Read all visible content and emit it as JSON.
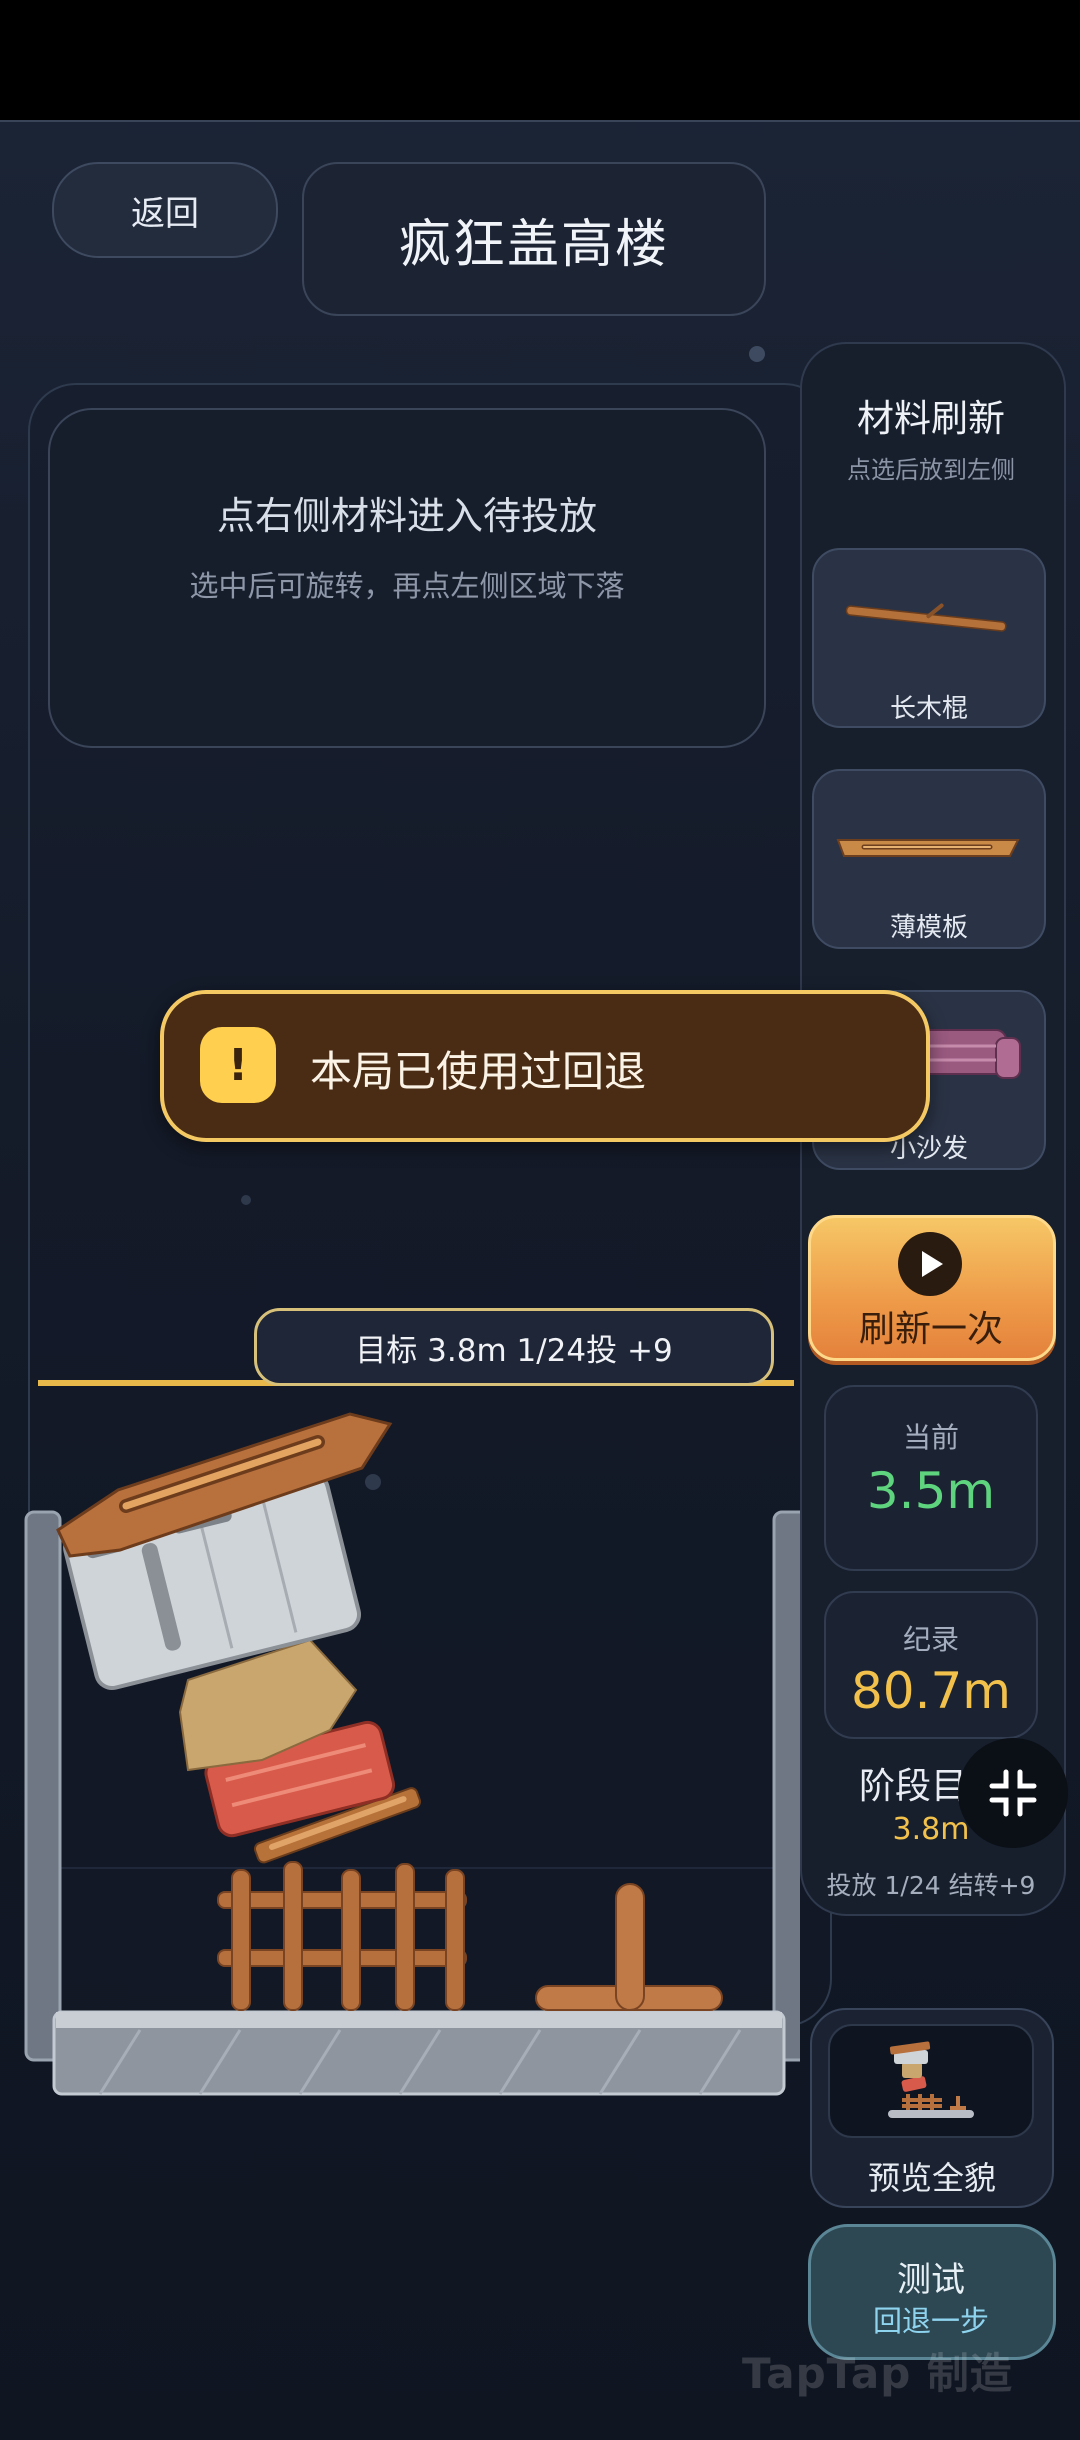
{
  "header": {
    "back_label": "返回",
    "title": "疯狂盖高楼"
  },
  "hint": {
    "title": "点右侧材料进入待投放",
    "subtitle": "选中后可旋转，再点左侧区域下落"
  },
  "panel": {
    "title": "材料刷新",
    "subtitle": "点选后放到左侧",
    "materials": [
      {
        "label": "长木棍",
        "icon": "wooden-stick-icon"
      },
      {
        "label": "薄模板",
        "icon": "thin-board-icon"
      },
      {
        "label": "小沙发",
        "icon": "small-sofa-icon"
      }
    ],
    "refresh_label": "刷新一次",
    "current_label": "当前",
    "current_value": "3.5m",
    "record_label": "纪录",
    "record_value": "80.7m",
    "stage_title": "阶段目标",
    "stage_target": "3.8m",
    "stage_drop": "投放 1/24 结转+9",
    "preview_label": "预览全貌",
    "test_label": "测试",
    "test_sub": "回退一步"
  },
  "target_bar": {
    "label": "目标 3.8m  1/24投 +9"
  },
  "toast": {
    "icon": "!",
    "message": "本局已使用过回退"
  },
  "watermark": "TapTap 制造",
  "colors": {
    "background": "#141b29",
    "accent_gold": "#e8b84a",
    "current_green": "#5fd47e",
    "record_gold": "#f2c14b",
    "refresh_orange": "#ee9a48",
    "toast_brown": "#4a2c15"
  }
}
